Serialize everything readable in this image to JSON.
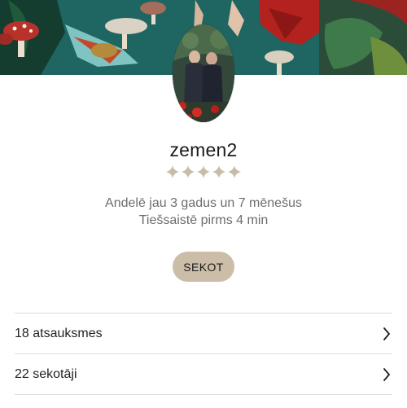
{
  "profile": {
    "username": "zemen2",
    "rating_stars": 5,
    "member_since": "Andelē jau 3 gadus un 7 mēnešus",
    "last_online": "Tiešsaistē pirms 4 min",
    "follow_label": "SEKOT"
  },
  "stats": [
    {
      "label": "18 atsauksmes",
      "icon": "chevron-right-icon"
    },
    {
      "label": "22 sekotāji",
      "icon": "chevron-right-icon"
    }
  ],
  "colors": {
    "banner_bg": "#1d5f5a",
    "accent_beige": "#cbbda8",
    "star": "#c9bca6",
    "divider": "#dcdcdc"
  }
}
